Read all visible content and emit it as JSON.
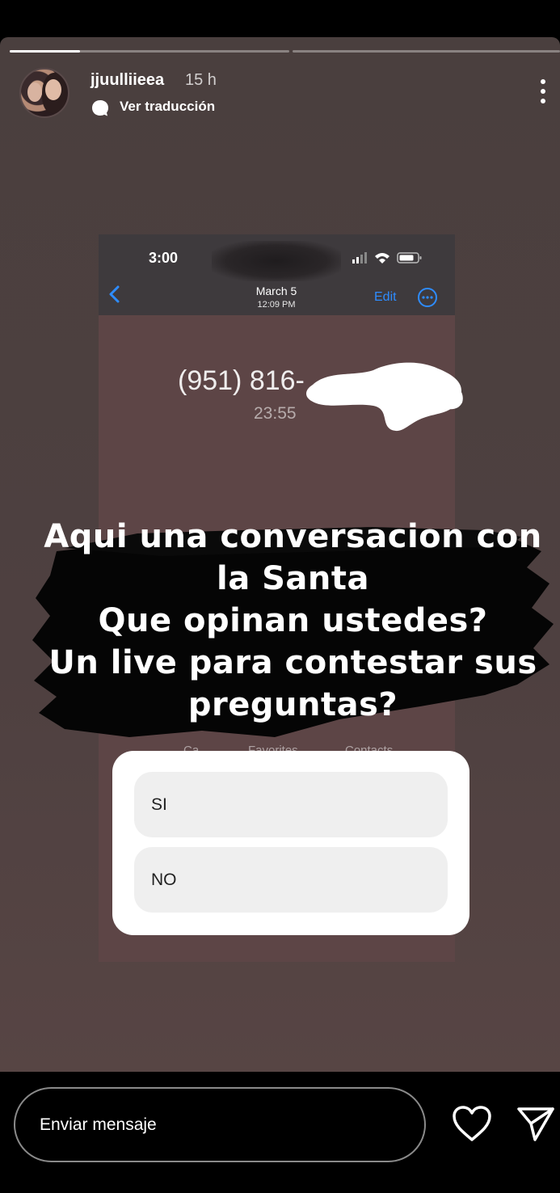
{
  "story": {
    "segment_count": 2,
    "current_segment": 1,
    "current_progress": 0.25
  },
  "header": {
    "username": "jjuulliieea",
    "time_ago": "15 h",
    "translate_label": "Ver traducción",
    "avatar_icon": "profile-avatar",
    "more_icon": "more-vertical-icon"
  },
  "screenshot": {
    "status_time": "3:00",
    "date": "March 5",
    "time": "12:09 PM",
    "edit_label": "Edit",
    "phone_number": "(951) 816-",
    "call_duration": "23:55",
    "tabs": [
      "Ca",
      "Favorites",
      "Contacts"
    ]
  },
  "caption": {
    "lines": [
      "Aqui una conversacion con",
      "la Santa",
      "Que opinan ustedes?",
      "Un live para contestar sus",
      "preguntas?"
    ]
  },
  "poll": {
    "options": [
      {
        "label": "SI"
      },
      {
        "label": "NO"
      }
    ]
  },
  "reply": {
    "placeholder": "Enviar mensaje",
    "like_icon": "heart-icon",
    "send_icon": "send-icon"
  },
  "colors": {
    "background": "#000000",
    "story_background": "#4e4040",
    "accent_link": "#2e8cff",
    "poll_option_bg": "#efefef"
  }
}
